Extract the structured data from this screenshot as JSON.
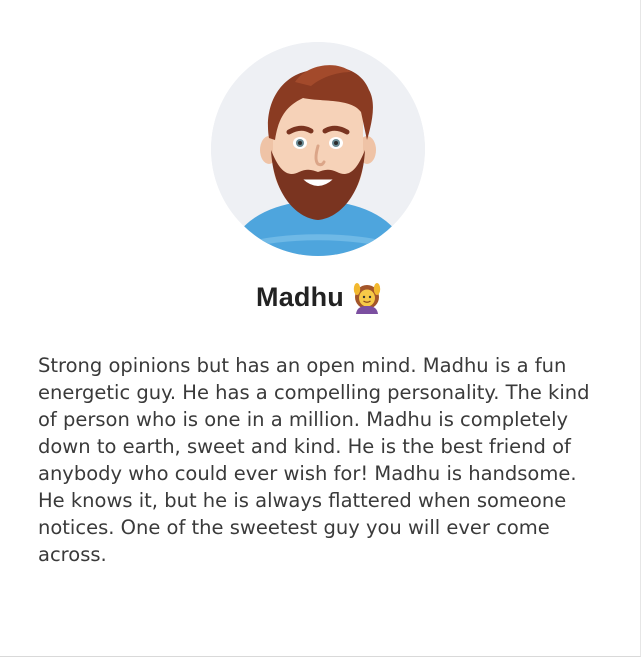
{
  "profile": {
    "name": "Madhu",
    "emoji": "woman-with-bunny-ears-icon",
    "avatar": "bearded-man-avatar",
    "bio": "Strong opinions but has an open mind. Madhu is a fun\nenergetic guy. He has a compelling personality.  The kind\nof person who is one in a million. Madhu is completely\ndown to earth, sweet and kind. He is the best friend of\nanybody who could ever wish for!  Madhu is handsome.\nHe knows it, but he is always flattered when someone\nnotices. One of the sweetest guy you will ever come\nacross."
  },
  "colors": {
    "avatar_bg": "#eef0f4",
    "hair": "#8a3b22",
    "beard": "#7a3420",
    "skin": "#f6d2b8",
    "shirt": "#4ea5dd",
    "text": "#3a3a3a",
    "name": "#222222"
  }
}
